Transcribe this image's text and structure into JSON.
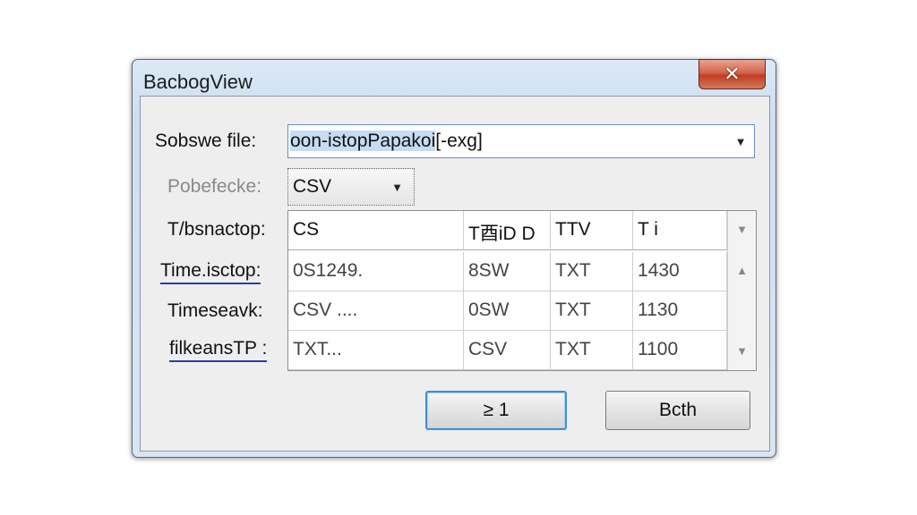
{
  "window": {
    "title": "BacbogView",
    "close_glyph": "✕"
  },
  "form": {
    "source_label": "Sobswe file:",
    "source_value_selected": "oon-istopPapakoi",
    "source_value_rest": "[-exg]",
    "format_label": "Pobefecke:",
    "format_value": "CSV",
    "table_label": "T/bsnactop:",
    "row_labels": [
      "Time.isctop:",
      "Timeseavk:",
      "filkeansTP :"
    ]
  },
  "grid": {
    "columns": [
      "CS",
      "T⾣iD D",
      "TTV",
      "T i"
    ],
    "rows": [
      [
        "0S1249.",
        "8SW",
        "TXT",
        "1430"
      ],
      [
        "CSV  ....",
        "0SW",
        "TXT",
        "1130"
      ],
      [
        "TXT...",
        "CSV",
        "TXT",
        "1100"
      ]
    ]
  },
  "buttons": {
    "ok_label": "≥ 1",
    "cancel_label": "Bcth"
  },
  "icons": {
    "dropdown": "▼",
    "scroll_up": "▲",
    "scroll_down": "▼"
  },
  "colors": {
    "close_red": "#c13d22",
    "focus_blue": "#3f8fd6",
    "selection": "#c6dcf2"
  }
}
